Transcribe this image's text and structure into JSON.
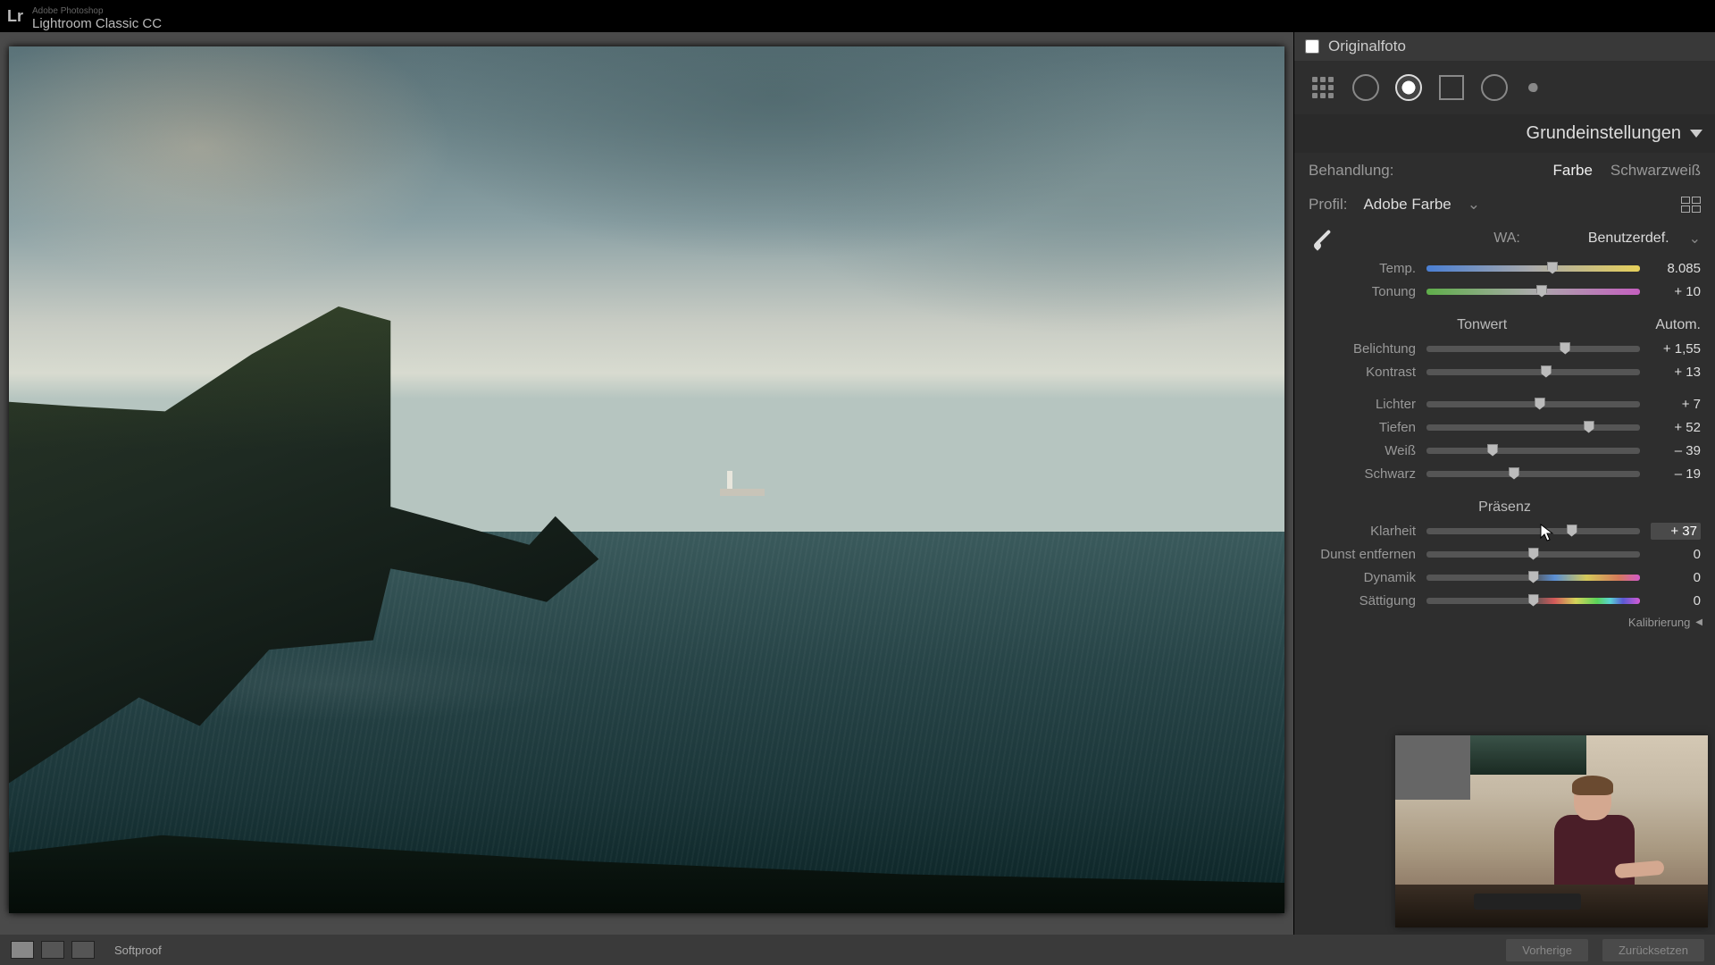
{
  "app": {
    "brand": "Lr",
    "sub": "Adobe Photoshop",
    "name": "Lightroom Classic CC"
  },
  "original_checkbox": "Originalfoto",
  "panel_title": "Grundeinstellungen",
  "treatment": {
    "label": "Behandlung:",
    "color": "Farbe",
    "bw": "Schwarzweiß"
  },
  "profile": {
    "label": "Profil:",
    "value": "Adobe Farbe"
  },
  "wb": {
    "label": "WA:",
    "value": "Benutzerdef."
  },
  "sliders": {
    "temp": {
      "label": "Temp.",
      "value": "8.085",
      "pos": 59
    },
    "tint": {
      "label": "Tonung",
      "value": "+ 10",
      "pos": 54
    },
    "exposure": {
      "label": "Belichtung",
      "value": "+ 1,55",
      "pos": 65
    },
    "contrast": {
      "label": "Kontrast",
      "value": "+ 13",
      "pos": 56
    },
    "high": {
      "label": "Lichter",
      "value": "+ 7",
      "pos": 53
    },
    "shad": {
      "label": "Tiefen",
      "value": "+ 52",
      "pos": 76
    },
    "white": {
      "label": "Weiß",
      "value": "– 39",
      "pos": 31
    },
    "black": {
      "label": "Schwarz",
      "value": "– 19",
      "pos": 41
    },
    "clarity": {
      "label": "Klarheit",
      "value": "+ 37",
      "pos": 68
    },
    "dehaze": {
      "label": "Dunst entfernen",
      "value": "0",
      "pos": 50
    },
    "vibrance": {
      "label": "Dynamik",
      "value": "0",
      "pos": 50
    },
    "sat": {
      "label": "Sättigung",
      "value": "0",
      "pos": 50
    }
  },
  "sections": {
    "tone": "Tonwert",
    "auto": "Autom.",
    "presence": "Präsenz"
  },
  "calibration": "Kalibrierung",
  "bottom": {
    "softproof": "Softproof",
    "prev": "Vorherige",
    "reset": "Zurücksetzen"
  }
}
